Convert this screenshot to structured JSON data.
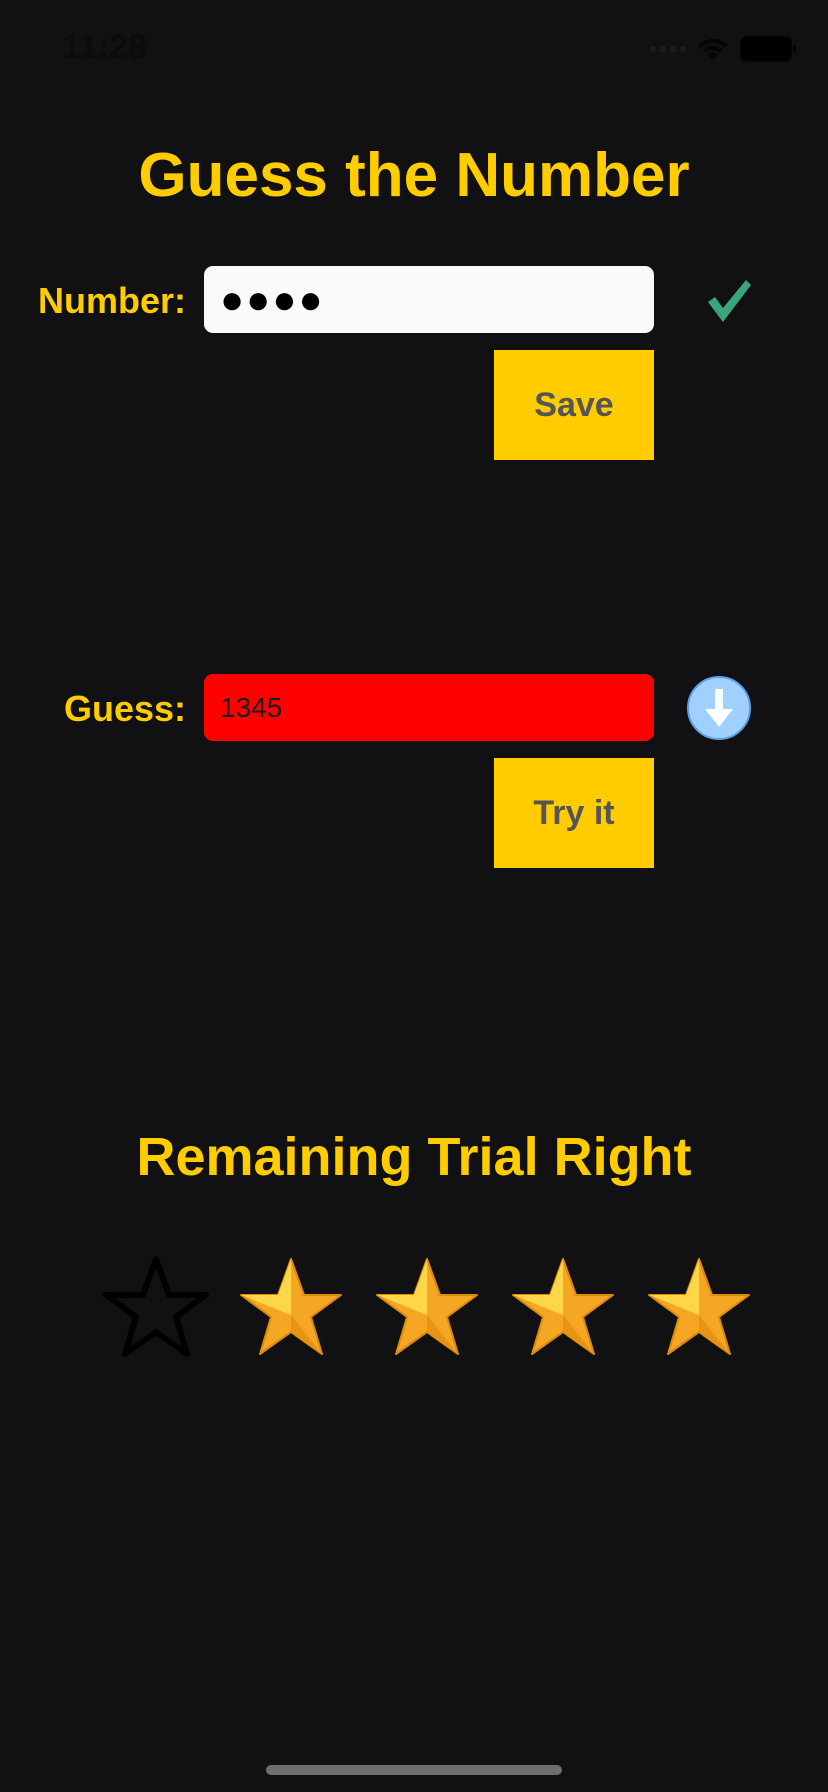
{
  "status": {
    "time": "11:28"
  },
  "title": "Guess the Number",
  "number": {
    "label": "Number:",
    "masked_value": "●●●●",
    "save_label": "Save"
  },
  "guess": {
    "label": "Guess:",
    "value": "1345",
    "try_label": "Try it",
    "hint": "lower"
  },
  "remaining": {
    "title": "Remaining Trial Right",
    "total": 5,
    "remaining": 4
  },
  "colors": {
    "accent": "#ffcc00",
    "background": "#111113",
    "error": "#ff0000",
    "check": "#3aa57a",
    "hint": "#9fd0ff"
  }
}
